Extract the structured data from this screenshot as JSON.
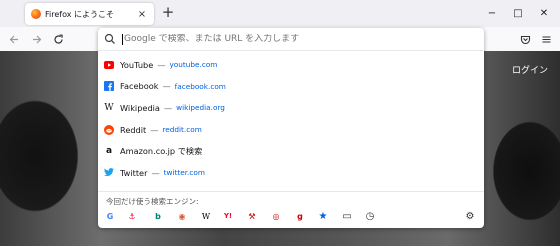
{
  "tab": {
    "title": "Firefox にようこそ",
    "close": "×"
  },
  "toolbar": {
    "new_tab": "+"
  },
  "window": {
    "minimize": "−",
    "maximize": "□",
    "close": "✕"
  },
  "page": {
    "login": "ログイン"
  },
  "urlbar": {
    "placeholder": "Google で検索、または URL を入力します"
  },
  "suggestions": [
    {
      "title": "YouTube",
      "url": "youtube.com",
      "icon": "youtube-icon",
      "color": "#ff0000"
    },
    {
      "title": "Facebook",
      "url": "facebook.com",
      "icon": "facebook-icon",
      "color": "#1877f2"
    },
    {
      "title": "Wikipedia",
      "url": "wikipedia.org",
      "icon": "wikipedia-icon",
      "color": "#000000"
    },
    {
      "title": "Reddit",
      "url": "reddit.com",
      "icon": "reddit-icon",
      "color": "#ff4500"
    },
    {
      "title": "Amazon.co.jp で検索",
      "url": "",
      "icon": "amazon-icon",
      "color": "#000000"
    },
    {
      "title": "Twitter",
      "url": "twitter.com",
      "icon": "twitter-icon",
      "color": "#1da1f2"
    }
  ],
  "separator": "—",
  "one_off": {
    "label": "今回だけ使う検索エンジン:",
    "engines": [
      {
        "name": "google-engine-icon",
        "glyph": "G",
        "color": "#4285f4"
      },
      {
        "name": "yahoo-japan-engine-icon",
        "glyph": "⚓",
        "color": "#ff0033"
      },
      {
        "name": "bing-engine-icon",
        "glyph": "b",
        "color": "#008373"
      },
      {
        "name": "duckduckgo-engine-icon",
        "glyph": "◉",
        "color": "#de5833"
      },
      {
        "name": "wikipedia-engine-icon",
        "glyph": "W",
        "color": "#000000"
      },
      {
        "name": "yahoo-auctions-engine-icon",
        "glyph": "Y!",
        "color": "#ff0033"
      },
      {
        "name": "rakuten-engine-icon",
        "glyph": "⚒",
        "color": "#bf0000"
      },
      {
        "name": "goo-engine-icon",
        "glyph": "◎",
        "color": "#cc0000"
      },
      {
        "name": "goo-dictionary-engine-icon",
        "glyph": "g",
        "color": "#cc0000"
      },
      {
        "name": "bookmarks-icon",
        "glyph": "★",
        "color": "#0061e0"
      },
      {
        "name": "tabs-icon",
        "glyph": "▭",
        "color": "#333333"
      },
      {
        "name": "history-icon",
        "glyph": "◷",
        "color": "#333333"
      }
    ],
    "settings": "⚙"
  }
}
